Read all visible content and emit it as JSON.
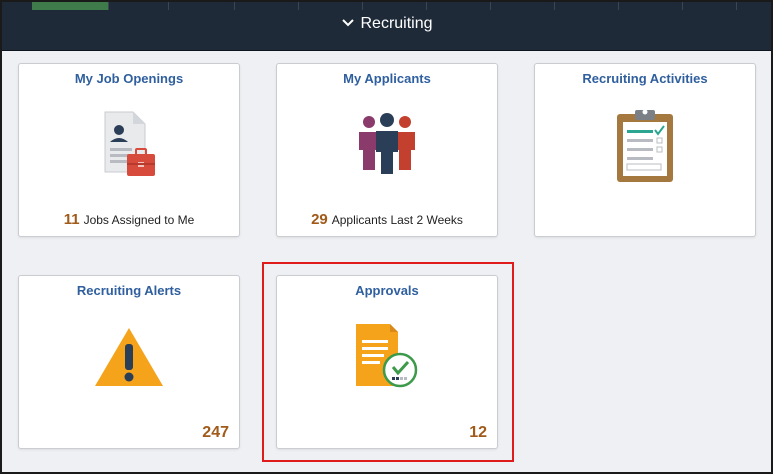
{
  "section": {
    "title": "Recruiting",
    "chevron_icon": "chevron-down-icon"
  },
  "colors": {
    "header_bg": "#1f2a38",
    "tile_title": "#2f5f9e",
    "count": "#a05a19",
    "highlight": "#e01b1b"
  },
  "tiles": [
    {
      "title": "My Job Openings",
      "icon": "job-openings-icon",
      "count": "11",
      "caption": "Jobs Assigned to Me"
    },
    {
      "title": "My Applicants",
      "icon": "applicants-icon",
      "count": "29",
      "caption": "Applicants Last 2 Weeks"
    },
    {
      "title": "Recruiting Activities",
      "icon": "clipboard-icon"
    },
    {
      "title": "Recruiting Alerts",
      "icon": "warning-icon",
      "count": "247"
    },
    {
      "title": "Approvals",
      "icon": "approvals-icon",
      "count": "12",
      "highlighted": true
    }
  ]
}
